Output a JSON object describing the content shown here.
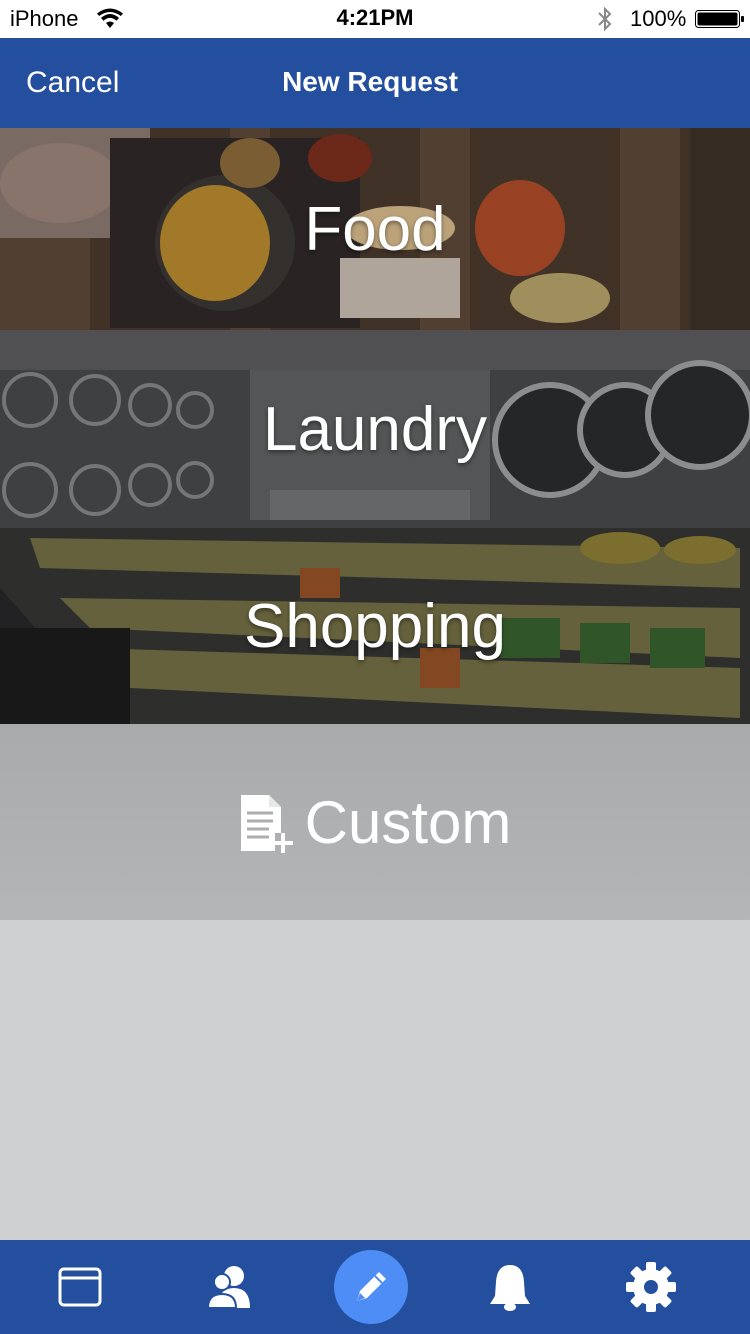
{
  "status_bar": {
    "carrier": "iPhone",
    "time": "4:21PM",
    "battery": "100%"
  },
  "nav": {
    "cancel_label": "Cancel",
    "title": "New Request"
  },
  "categories": [
    {
      "label": "Food"
    },
    {
      "label": "Laundry"
    },
    {
      "label": "Shopping"
    },
    {
      "label": "Custom"
    }
  ],
  "tab_bar": {
    "items": [
      {
        "icon": "window-icon"
      },
      {
        "icon": "contacts-icon"
      },
      {
        "icon": "pencil-icon",
        "active": true
      },
      {
        "icon": "bell-icon"
      },
      {
        "icon": "gear-icon"
      }
    ]
  },
  "colors": {
    "nav": "#244f9e",
    "active_tab": "#4d8df5",
    "custom_bg": "#adaeb0",
    "empty_bg": "#cfd0d2"
  }
}
